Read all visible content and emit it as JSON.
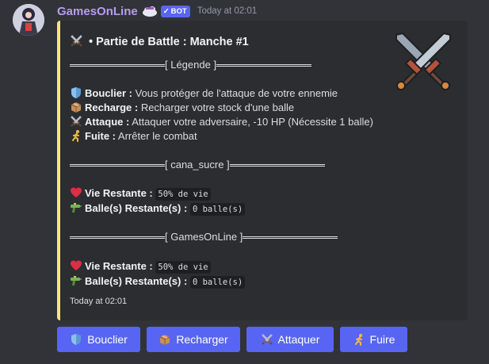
{
  "message": {
    "author": "GamesOnLine",
    "bot_tag": "BOT",
    "timestamp": "Today at 02:01"
  },
  "embed": {
    "title": "• Partie de Battle : Manche #1",
    "legend_separator": "[ Légende ]",
    "legend": [
      {
        "icon": "shield-icon",
        "label": "Bouclier :",
        "text": " Vous protéger de l'attaque de votre ennemie"
      },
      {
        "icon": "package-icon",
        "label": "Recharge :",
        "text": " Recharger votre stock d'une balle"
      },
      {
        "icon": "crossed-swords-icon",
        "label": "Attaque :",
        "text": " Attaquer votre adversaire, -10 HP (Nécessite 1 balle)"
      },
      {
        "icon": "running-person-icon",
        "label": "Fuite :",
        "text": " Arrêter le combat"
      }
    ],
    "player1": {
      "separator": "[ cana_sucre ]",
      "life_label": "Vie Restante :",
      "life_value": "50% de vie",
      "ammo_label": "Balle(s) Restante(s) :",
      "ammo_value": "0 balle(s)"
    },
    "player2": {
      "separator": "[ GamesOnLine ]",
      "life_label": "Vie Restante :",
      "life_value": "50% de vie",
      "ammo_label": "Balle(s) Restante(s) :",
      "ammo_value": "0 balle(s)"
    },
    "footer": "Today at 02:01",
    "accent_color": "#f4e77c"
  },
  "buttons": [
    {
      "label": "Bouclier",
      "icon": "shield-icon"
    },
    {
      "label": "Recharger",
      "icon": "package-icon"
    },
    {
      "label": "Attaquer",
      "icon": "crossed-swords-icon"
    },
    {
      "label": "Fuire",
      "icon": "running-person-icon"
    }
  ],
  "colors": {
    "background": "#313338",
    "embed_background": "#2b2d31",
    "blurple": "#5865f2",
    "username": "#b89cf0"
  }
}
